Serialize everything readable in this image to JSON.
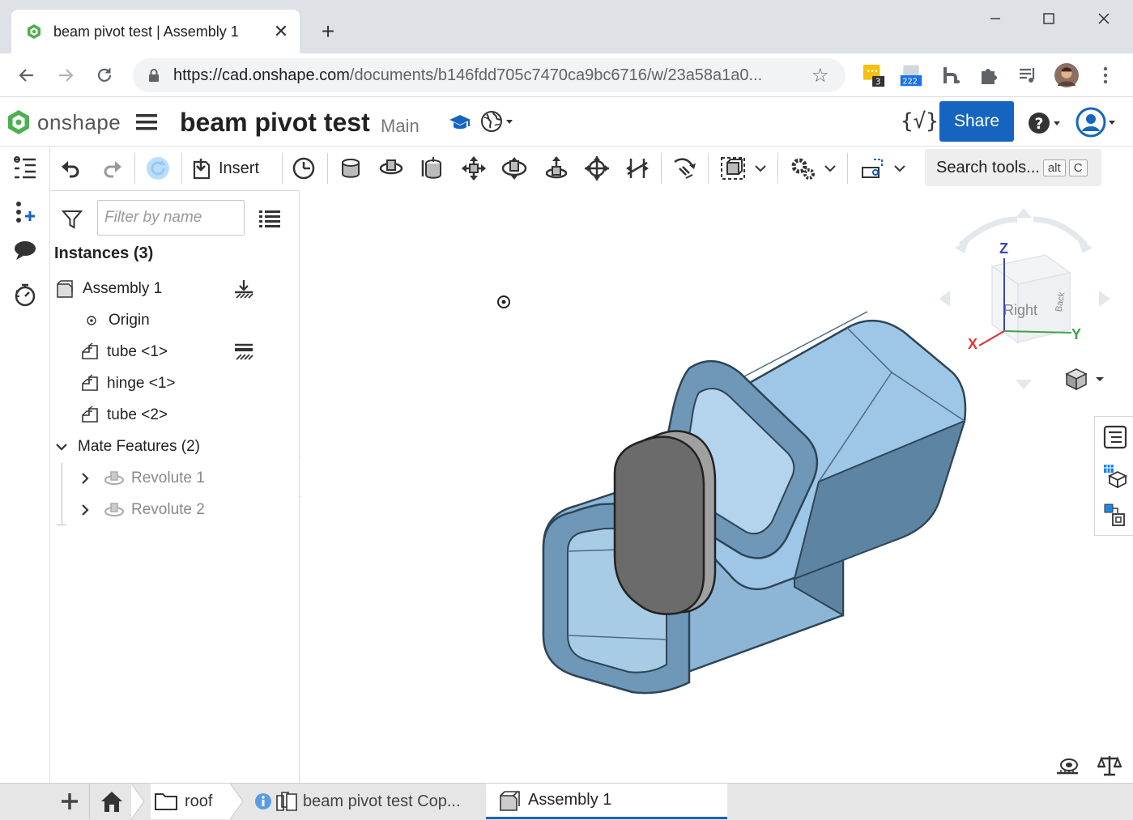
{
  "browser": {
    "tab_title": "beam pivot test | Assembly 1",
    "url_host": "https://cad.onshape.com",
    "url_path": "/documents/b146fdd705c7470ca9bc6716/w/23a58a1a0...",
    "extensions": [
      {
        "name": "ext-badge-3",
        "badge": "3"
      },
      {
        "name": "ext-badge-222",
        "badge": "222"
      }
    ]
  },
  "header": {
    "logo_text": "onshape",
    "doc_title": "beam pivot test",
    "branch": "Main",
    "share_label": "Share"
  },
  "toolbar": {
    "insert_label": "Insert",
    "search_label": "Search tools...",
    "search_key1": "alt",
    "search_key2": "C"
  },
  "panel": {
    "filter_placeholder": "Filter by name",
    "instances_title": "Instances (3)",
    "instances": [
      {
        "label": "Assembly 1"
      },
      {
        "label": "Origin"
      },
      {
        "label": "tube <1>"
      },
      {
        "label": "hinge <1>"
      },
      {
        "label": "tube <2>"
      }
    ],
    "mates_title": "Mate Features (2)",
    "mates": [
      {
        "label": "Revolute 1"
      },
      {
        "label": "Revolute 2"
      }
    ]
  },
  "viewcube": {
    "axis_z": "Z",
    "axis_x": "X",
    "axis_y": "Y",
    "face_right": "Right",
    "face_back": "Back"
  },
  "bottom_tabs": {
    "folder_label": "roof",
    "doc_tab_label": "beam pivot test Cop...",
    "active_tab_label": "Assembly 1"
  },
  "colors": {
    "share_blue": "#1565c0",
    "part_blue": "#9ec6e6",
    "part_edge": "#3d5a6e",
    "hinge_gray": "#6b6b6b"
  }
}
